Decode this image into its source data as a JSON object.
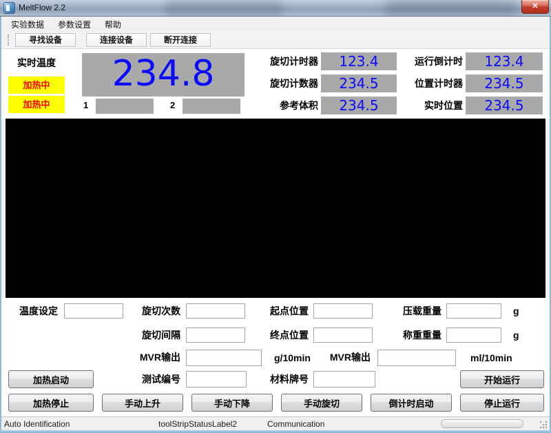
{
  "window": {
    "title": "MeltFlow 2.2",
    "close_label": "✕"
  },
  "menu": {
    "items": [
      {
        "label": "实验数据"
      },
      {
        "label": "参数设置"
      },
      {
        "label": "帮助"
      }
    ]
  },
  "toolbar": {
    "buttons": [
      {
        "label": "寻找设备"
      },
      {
        "label": "连接设备"
      },
      {
        "label": "断开连接"
      }
    ]
  },
  "temperature": {
    "label": "实时温度",
    "heater_status_1": "加热中",
    "heater_status_2": "加热中",
    "value": "234.8",
    "zone_1": "1",
    "zone_2": "2"
  },
  "readouts": {
    "left": [
      {
        "label": "旋切计时器",
        "value": "123.4"
      },
      {
        "label": "旋切计数器",
        "value": "234.5"
      },
      {
        "label": "参考体积",
        "value": "234.5"
      }
    ],
    "right": [
      {
        "label": "运行倒计时",
        "value": "123.4"
      },
      {
        "label": "位置计时器",
        "value": "234.5"
      },
      {
        "label": "实时位置",
        "value": "234.5"
      }
    ]
  },
  "form": {
    "temp_setting_label": "温度设定",
    "cut_count_label": "旋切次数",
    "cut_interval_label": "旋切间隔",
    "start_pos_label": "起点位置",
    "end_pos_label": "终点位置",
    "load_weight_label": "压载重量",
    "weigh_weight_label": "称重重量",
    "unit_g_1": "g",
    "unit_g_2": "g",
    "mvr_out_1_label": "MVR输出",
    "mvr_out_1_unit": "g/10min",
    "mvr_out_2_label": "MVR输出",
    "mvr_out_2_unit": "ml/10min",
    "test_id_label": "测试编号",
    "material_label": "材料牌号"
  },
  "buttons": {
    "heat_start": "加热启动",
    "heat_stop": "加热停止",
    "manual_up": "手动上升",
    "manual_down": "手动下降",
    "manual_cut": "手动旋切",
    "countdown_start": "倒计时启动",
    "run_start": "开始运行",
    "run_stop": "停止运行"
  },
  "statusbar": {
    "left": "Auto Identification",
    "center": "toolStripStatusLabel2",
    "right": "Communication"
  },
  "colors": {
    "display_bg": "#a9a9a9",
    "value_text": "#0a0aff",
    "heater_bg": "#ffff00",
    "heater_text": "#ff0000"
  }
}
